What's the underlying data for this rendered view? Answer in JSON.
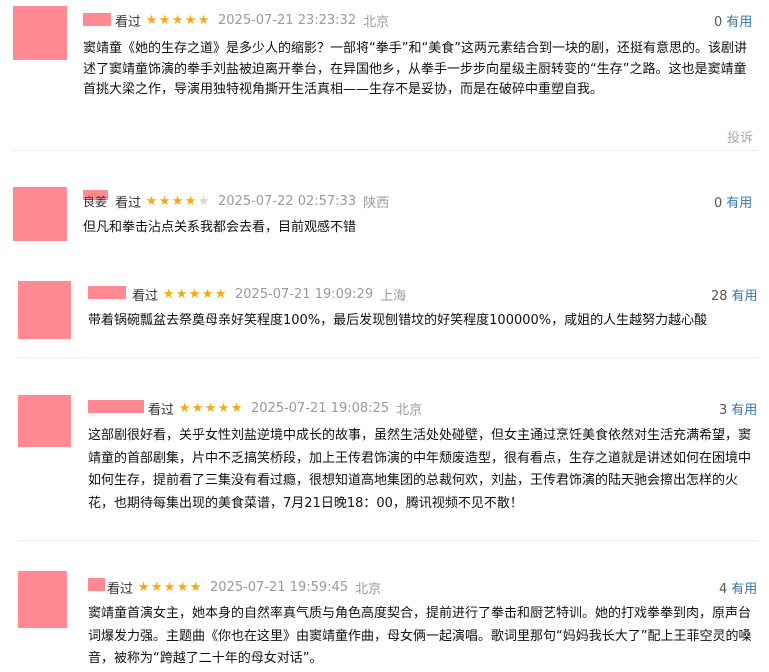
{
  "comments": [
    {
      "user": "",
      "watched": "看过",
      "rating": 5,
      "time": "2025-07-21 23:23:32",
      "location": "北京",
      "votes": "0",
      "useful_label": "有用",
      "content": "窦靖童《她的生存之道》是多少人的缩影？一部将“拳手”和“美食”这两元素结合到一块的剧，还挺有意思的。该剧讲述了窦靖童饰演的拳手刘盐被迫离开拳台，在异国他乡，从拳手一步步向星级主厨转变的“生存”之路。这也是窦靖童首挑大梁之作，导演用独特视角撕开生活真相——生存不是妥协，而是在破碎中重塑自我。",
      "report_label": "投诉"
    },
    {
      "user": "良姜",
      "watched": "看过",
      "rating": 4,
      "time": "2025-07-22 02:57:33",
      "location": "陕西",
      "votes": "0",
      "useful_label": "有用",
      "content": "但凡和拳击沾点关系我都会去看，目前观感不错"
    },
    {
      "user": "",
      "watched": "看过",
      "rating": 5,
      "time": "2025-07-21 19:09:29",
      "location": "上海",
      "votes": "28",
      "useful_label": "有用",
      "content": "带着锅碗瓢盆去祭奠母亲好笑程度100%，最后发现刨错坟的好笑程度100000%，咸姐的人生越努力越心酸"
    },
    {
      "user": "",
      "watched": "看过",
      "rating": 5,
      "time": "2025-07-21 19:08:25",
      "location": "北京",
      "votes": "3",
      "useful_label": "有用",
      "content": "这部剧很好看，关乎女性刘盐逆境中成长的故事，虽然生活处处碰壁，但女主通过烹饪美食依然对生活充满希望，窦靖童的首部剧集，片中不乏搞笑桥段，加上王传君饰演的中年颓废造型，很有看点，生存之道就是讲述如何在困境中如何生存，提前看了三集没有看过瘾，很想知道高地集团的总裁何欢，刘盐，王传君饰演的陆天驰会擦出怎样的火花，也期待每集出现的美食菜谱，7月21日晚18：00，腾讯视频不见不散！"
    },
    {
      "user": "",
      "watched": "看过",
      "rating": 5,
      "time": "2025-07-21 19:59:45",
      "location": "北京",
      "votes": "4",
      "useful_label": "有用",
      "content": "窦靖童首演女主，她本身的自然率真气质与角色高度契合，提前进行了拳击和厨艺特训。她的打戏拳拳到肉，原声台词爆发力强。主题曲《你也在这里》由窦靖童作曲，母女俩一起演唱。歌词里那句“妈妈我长大了”配上王菲空灵的嗓音，被称为“跨越了二十年的母女对话”。"
    }
  ],
  "colors": {
    "accent": "#3377aa",
    "star": "#f7a814",
    "avatar": "#ff8a93",
    "meta": "#9a9a9a"
  }
}
